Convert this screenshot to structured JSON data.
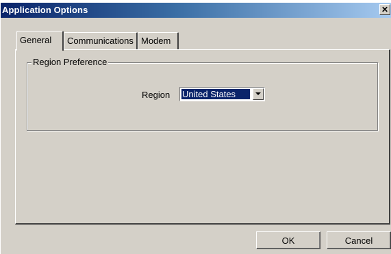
{
  "window": {
    "title": "Application Options",
    "close_label": "✕"
  },
  "tabs": [
    {
      "label": "General",
      "active": true
    },
    {
      "label": "Communications",
      "active": false
    },
    {
      "label": "Modem",
      "active": false
    }
  ],
  "region_group": {
    "legend": "Region Preference",
    "region_label": "Region",
    "region_value": "United States"
  },
  "buttons": {
    "ok_label": "OK",
    "cancel_label": "Cancel"
  },
  "colors": {
    "title_bar_start": "#0a246a",
    "title_bar_end": "#a6caf0",
    "face": "#d4d0c8",
    "selection": "#0a246a"
  }
}
